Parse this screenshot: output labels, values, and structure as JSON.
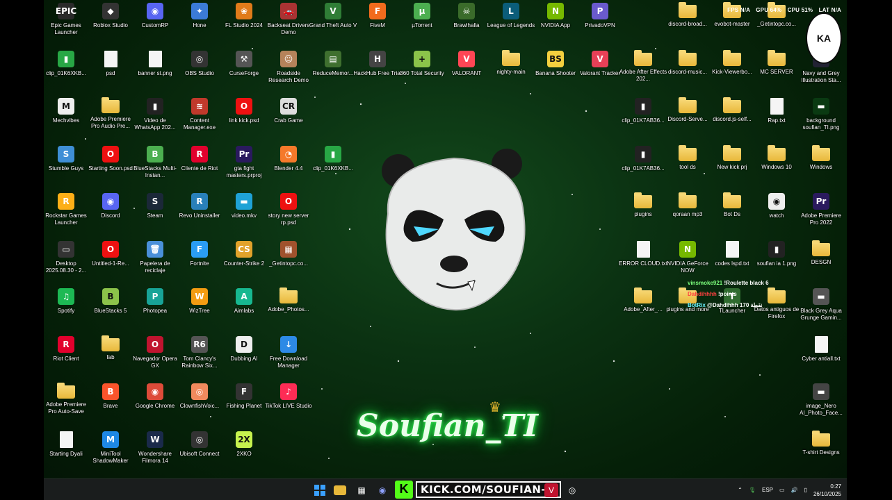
{
  "overlay": {
    "fps": "FPS N/A",
    "gpu": "GPU 64%",
    "cpu": "CPU 51%",
    "lat": "LAT N/A"
  },
  "brand_text": "Soufian_TI",
  "logo_text": "KA",
  "chat": [
    {
      "user": "vinsmoke921",
      "msg": "!Roulette black 6"
    },
    {
      "user": "Dahdihhhh",
      "msg": "!points"
    },
    {
      "user": "BotRix",
      "msg": "@Dahdihhh 170 نقطة"
    }
  ],
  "icons": [
    {
      "label": "Epic Games Launcher",
      "glyph": "EPIC",
      "color": "#2a2a2a"
    },
    {
      "label": "Roblox Studio",
      "glyph": "◆",
      "color": "#333"
    },
    {
      "label": "CustomRP",
      "glyph": "◉",
      "color": "#5865f2"
    },
    {
      "label": "Hone",
      "glyph": "✦",
      "color": "#3b7bd6"
    },
    {
      "label": "FL Studio 2024",
      "glyph": "❀",
      "color": "#e07b1a"
    },
    {
      "label": "Backseat Drivers Demo",
      "glyph": "🚗",
      "color": "#a33"
    },
    {
      "label": "Grand Theft Auto V",
      "glyph": "V",
      "color": "#2f7d36"
    },
    {
      "label": "FiveM",
      "glyph": "F",
      "color": "#f26b1d"
    },
    {
      "label": "µTorrent",
      "glyph": "µ",
      "color": "#4caf50"
    },
    {
      "label": "Brawlhalla",
      "glyph": "☠",
      "color": "#3a6b2a"
    },
    {
      "label": "League of Legends",
      "glyph": "L",
      "color": "#0b5d7a"
    },
    {
      "label": "NVIDIA App",
      "glyph": "N",
      "color": "#76b900"
    },
    {
      "label": "PrivadoVPN",
      "glyph": "P",
      "color": "#6a5acd"
    },
    {
      "label": "clip_01K6XKB...",
      "glyph": "▮",
      "color": "#28a745"
    },
    {
      "label": "psd",
      "glyph": "doc",
      "color": ""
    },
    {
      "label": "banner st.png",
      "glyph": "doc",
      "color": ""
    },
    {
      "label": "OBS Studio",
      "glyph": "◎",
      "color": "#333"
    },
    {
      "label": "CurseForge",
      "glyph": "⚒",
      "color": "#555"
    },
    {
      "label": "Roadside Research Demo",
      "glyph": "☺",
      "color": "#b5835a"
    },
    {
      "label": "ReduceMemor...",
      "glyph": "▤",
      "color": "#3f6f2f"
    },
    {
      "label": "HackHub Free Trial",
      "glyph": "H",
      "color": "#444"
    },
    {
      "label": "360 Total Security",
      "glyph": "+",
      "color": "#8bc34a"
    },
    {
      "label": "VALORANT",
      "glyph": "V",
      "color": "#ff4655"
    },
    {
      "label": "nighty-main",
      "glyph": "folder",
      "color": ""
    },
    {
      "label": "Banana Shooter",
      "glyph": "BS",
      "color": "#f4d03f"
    },
    {
      "label": "Valorant Tracker",
      "glyph": "V",
      "color": "#e84057"
    },
    {
      "label": "Mechvibes",
      "glyph": "M",
      "color": "#eee"
    },
    {
      "label": "Adobe Premiere Pro Audio Pre...",
      "glyph": "folder",
      "color": ""
    },
    {
      "label": "Video de WhatsApp 202...",
      "glyph": "▮",
      "color": "#222"
    },
    {
      "label": "Content Manager.exe",
      "glyph": "≋",
      "color": "#c0392b"
    },
    {
      "label": "link kick.psd",
      "glyph": "O",
      "color": "#e11"
    },
    {
      "label": "Crab Game",
      "glyph": "CR",
      "color": "#ddd"
    },
    {
      "label": "Stumble Guys",
      "glyph": "S",
      "color": "#3f8fd6"
    },
    {
      "label": "Starting Soon.psd",
      "glyph": "O",
      "color": "#e11"
    },
    {
      "label": "BlueStacks Multi-Instan...",
      "glyph": "B",
      "color": "#4caf50"
    },
    {
      "label": "Cliente de Riot",
      "glyph": "R",
      "color": "#e2012d"
    },
    {
      "label": "gta fight masters.prproj",
      "glyph": "Pr",
      "color": "#2a1a5e"
    },
    {
      "label": "Blender 4.4",
      "glyph": "◔",
      "color": "#f5792a"
    },
    {
      "label": "clip_01K6XKB...",
      "glyph": "▮",
      "color": "#28a745"
    },
    {
      "label": "Rockstar Games Launcher",
      "glyph": "R",
      "color": "#fcaf17"
    },
    {
      "label": "Discord",
      "glyph": "◉",
      "color": "#5865f2"
    },
    {
      "label": "Steam",
      "glyph": "S",
      "color": "#1b2838"
    },
    {
      "label": "Revo Uninstaller",
      "glyph": "R",
      "color": "#2980b9"
    },
    {
      "label": "video.mkv",
      "glyph": "▬",
      "color": "#1fa2d6"
    },
    {
      "label": "story new server rp.psd",
      "glyph": "O",
      "color": "#e11"
    },
    {
      "label": "Desktop 2025.08.30 - 2...",
      "glyph": "▭",
      "color": "#333"
    },
    {
      "label": "Untitled-1-Re...",
      "glyph": "O",
      "color": "#e11"
    },
    {
      "label": "Papelera de reciclaje",
      "glyph": "🗑",
      "color": "#4a90d9"
    },
    {
      "label": "Fortnite",
      "glyph": "F",
      "color": "#2a9df4"
    },
    {
      "label": "Counter-Strike 2",
      "glyph": "CS",
      "color": "#e1a22b"
    },
    {
      "label": "_Getintopc.co...",
      "glyph": "▦",
      "color": "#a0522d"
    },
    {
      "label": "Spotify",
      "glyph": "♫",
      "color": "#1db954"
    },
    {
      "label": "BlueStacks 5",
      "glyph": "B",
      "color": "#8bc34a"
    },
    {
      "label": "Photopea",
      "glyph": "P",
      "color": "#18a497"
    },
    {
      "label": "WizTree",
      "glyph": "W",
      "color": "#f39c12"
    },
    {
      "label": "Aimlabs",
      "glyph": "A",
      "color": "#17b890"
    },
    {
      "label": "Adobe_Photos...",
      "glyph": "folder",
      "color": ""
    },
    {
      "label": "Riot Client",
      "glyph": "R",
      "color": "#e2012d"
    },
    {
      "label": "fab",
      "glyph": "folder",
      "color": ""
    },
    {
      "label": "Navegador Opera GX",
      "glyph": "O",
      "color": "#c0142f"
    },
    {
      "label": "Tom Clancy's Rainbow Six...",
      "glyph": "R6",
      "color": "#555"
    },
    {
      "label": "Dubbing AI",
      "glyph": "D",
      "color": "#eee"
    },
    {
      "label": "Free Download Manager",
      "glyph": "↓",
      "color": "#2d8ae6"
    },
    {
      "label": "Adobe Premiere Pro Auto-Save",
      "glyph": "folder",
      "color": ""
    },
    {
      "label": "Brave",
      "glyph": "B",
      "color": "#fb542b"
    },
    {
      "label": "Google Chrome",
      "glyph": "◉",
      "color": "#dd4b39"
    },
    {
      "label": "ClownfishVoic...",
      "glyph": "◎",
      "color": "#f08a5d"
    },
    {
      "label": "Fishing Planet",
      "glyph": "F",
      "color": "#333"
    },
    {
      "label": "TikTok LIVE Studio",
      "glyph": "♪",
      "color": "#fe2c55"
    },
    {
      "label": "Starting Dyali",
      "glyph": "doc",
      "color": ""
    },
    {
      "label": "MiniTool ShadowMaker",
      "glyph": "M",
      "color": "#1e88e5"
    },
    {
      "label": "Wondershare Filmora 14",
      "glyph": "W",
      "color": "#1a2a4a"
    },
    {
      "label": "Ubisoft Connect",
      "glyph": "◎",
      "color": "#333"
    },
    {
      "label": "2XKO",
      "glyph": "2X",
      "color": "#c6f24e"
    },
    {
      "label": "discord-broad...",
      "glyph": "folder",
      "color": ""
    },
    {
      "label": "evobot-master",
      "glyph": "folder",
      "color": ""
    },
    {
      "label": "_Getintopc.co...",
      "glyph": "folder",
      "color": ""
    },
    {
      "label": "Adobe After Effects 202...",
      "glyph": "folder",
      "color": ""
    },
    {
      "label": "discord-music...",
      "glyph": "folder",
      "color": ""
    },
    {
      "label": "Kick-Viewerbo...",
      "glyph": "folder",
      "color": ""
    },
    {
      "label": "MC SERVER",
      "glyph": "folder",
      "color": ""
    },
    {
      "label": "Navy and Grey Illustration Sta...",
      "glyph": "▮",
      "color": "#223"
    },
    {
      "label": "clip_01K7AB36...",
      "glyph": "▮",
      "color": "#222"
    },
    {
      "label": "Discord-Serve...",
      "glyph": "folder",
      "color": ""
    },
    {
      "label": "discord.js-self...",
      "glyph": "folder",
      "color": ""
    },
    {
      "label": "Rap.txt",
      "glyph": "doc",
      "color": ""
    },
    {
      "label": "background soufian_TI.png",
      "glyph": "▬",
      "color": "#0a3a12"
    },
    {
      "label": "clip_01K7AB36...",
      "glyph": "▮",
      "color": "#222"
    },
    {
      "label": "tool ds",
      "glyph": "folder",
      "color": ""
    },
    {
      "label": "New kick prj",
      "glyph": "folder",
      "color": ""
    },
    {
      "label": "Windows 10",
      "glyph": "folder",
      "color": ""
    },
    {
      "label": "Windows",
      "glyph": "folder",
      "color": ""
    },
    {
      "label": "plugins",
      "glyph": "folder",
      "color": ""
    },
    {
      "label": "qoraan mp3",
      "glyph": "folder",
      "color": ""
    },
    {
      "label": "Bot Ds",
      "glyph": "folder",
      "color": ""
    },
    {
      "label": "watch",
      "glyph": "◉",
      "color": "#eee"
    },
    {
      "label": "Adobe Premiere Pro 2022",
      "glyph": "Pr",
      "color": "#2a1a5e"
    },
    {
      "label": "ERROR CLOUD.txt",
      "glyph": "doc",
      "color": ""
    },
    {
      "label": "NVIDIA GeForce NOW",
      "glyph": "N",
      "color": "#76b900"
    },
    {
      "label": "codes lspd.txt",
      "glyph": "doc",
      "color": ""
    },
    {
      "label": "soufian ia 1.png",
      "glyph": "▮",
      "color": "#222"
    },
    {
      "label": "DESGN",
      "glyph": "folder",
      "color": ""
    },
    {
      "label": "Adobe_After_...",
      "glyph": "folder",
      "color": ""
    },
    {
      "label": "plugins and more",
      "glyph": "folder",
      "color": ""
    },
    {
      "label": "TLauncher",
      "glyph": "T",
      "color": "#2f6b2f"
    },
    {
      "label": "Datos antiguos de Firefox",
      "glyph": "folder",
      "color": ""
    },
    {
      "label": "Black Grey Aqua Grunge Gamin...",
      "glyph": "▬",
      "color": "#555"
    },
    {
      "label": "Cyber antiall.txt",
      "glyph": "doc",
      "color": ""
    },
    {
      "label": "image_Nero AI_Photo_Face...",
      "glyph": "▬",
      "color": "#444"
    },
    {
      "label": "T-shirt Designs",
      "glyph": "folder",
      "color": ""
    }
  ],
  "taskbar": {
    "kick_url": "KICK.COM/SOUFIAN-TI",
    "lang": "ESP",
    "time": "0:27",
    "date": "26/10/2025"
  }
}
